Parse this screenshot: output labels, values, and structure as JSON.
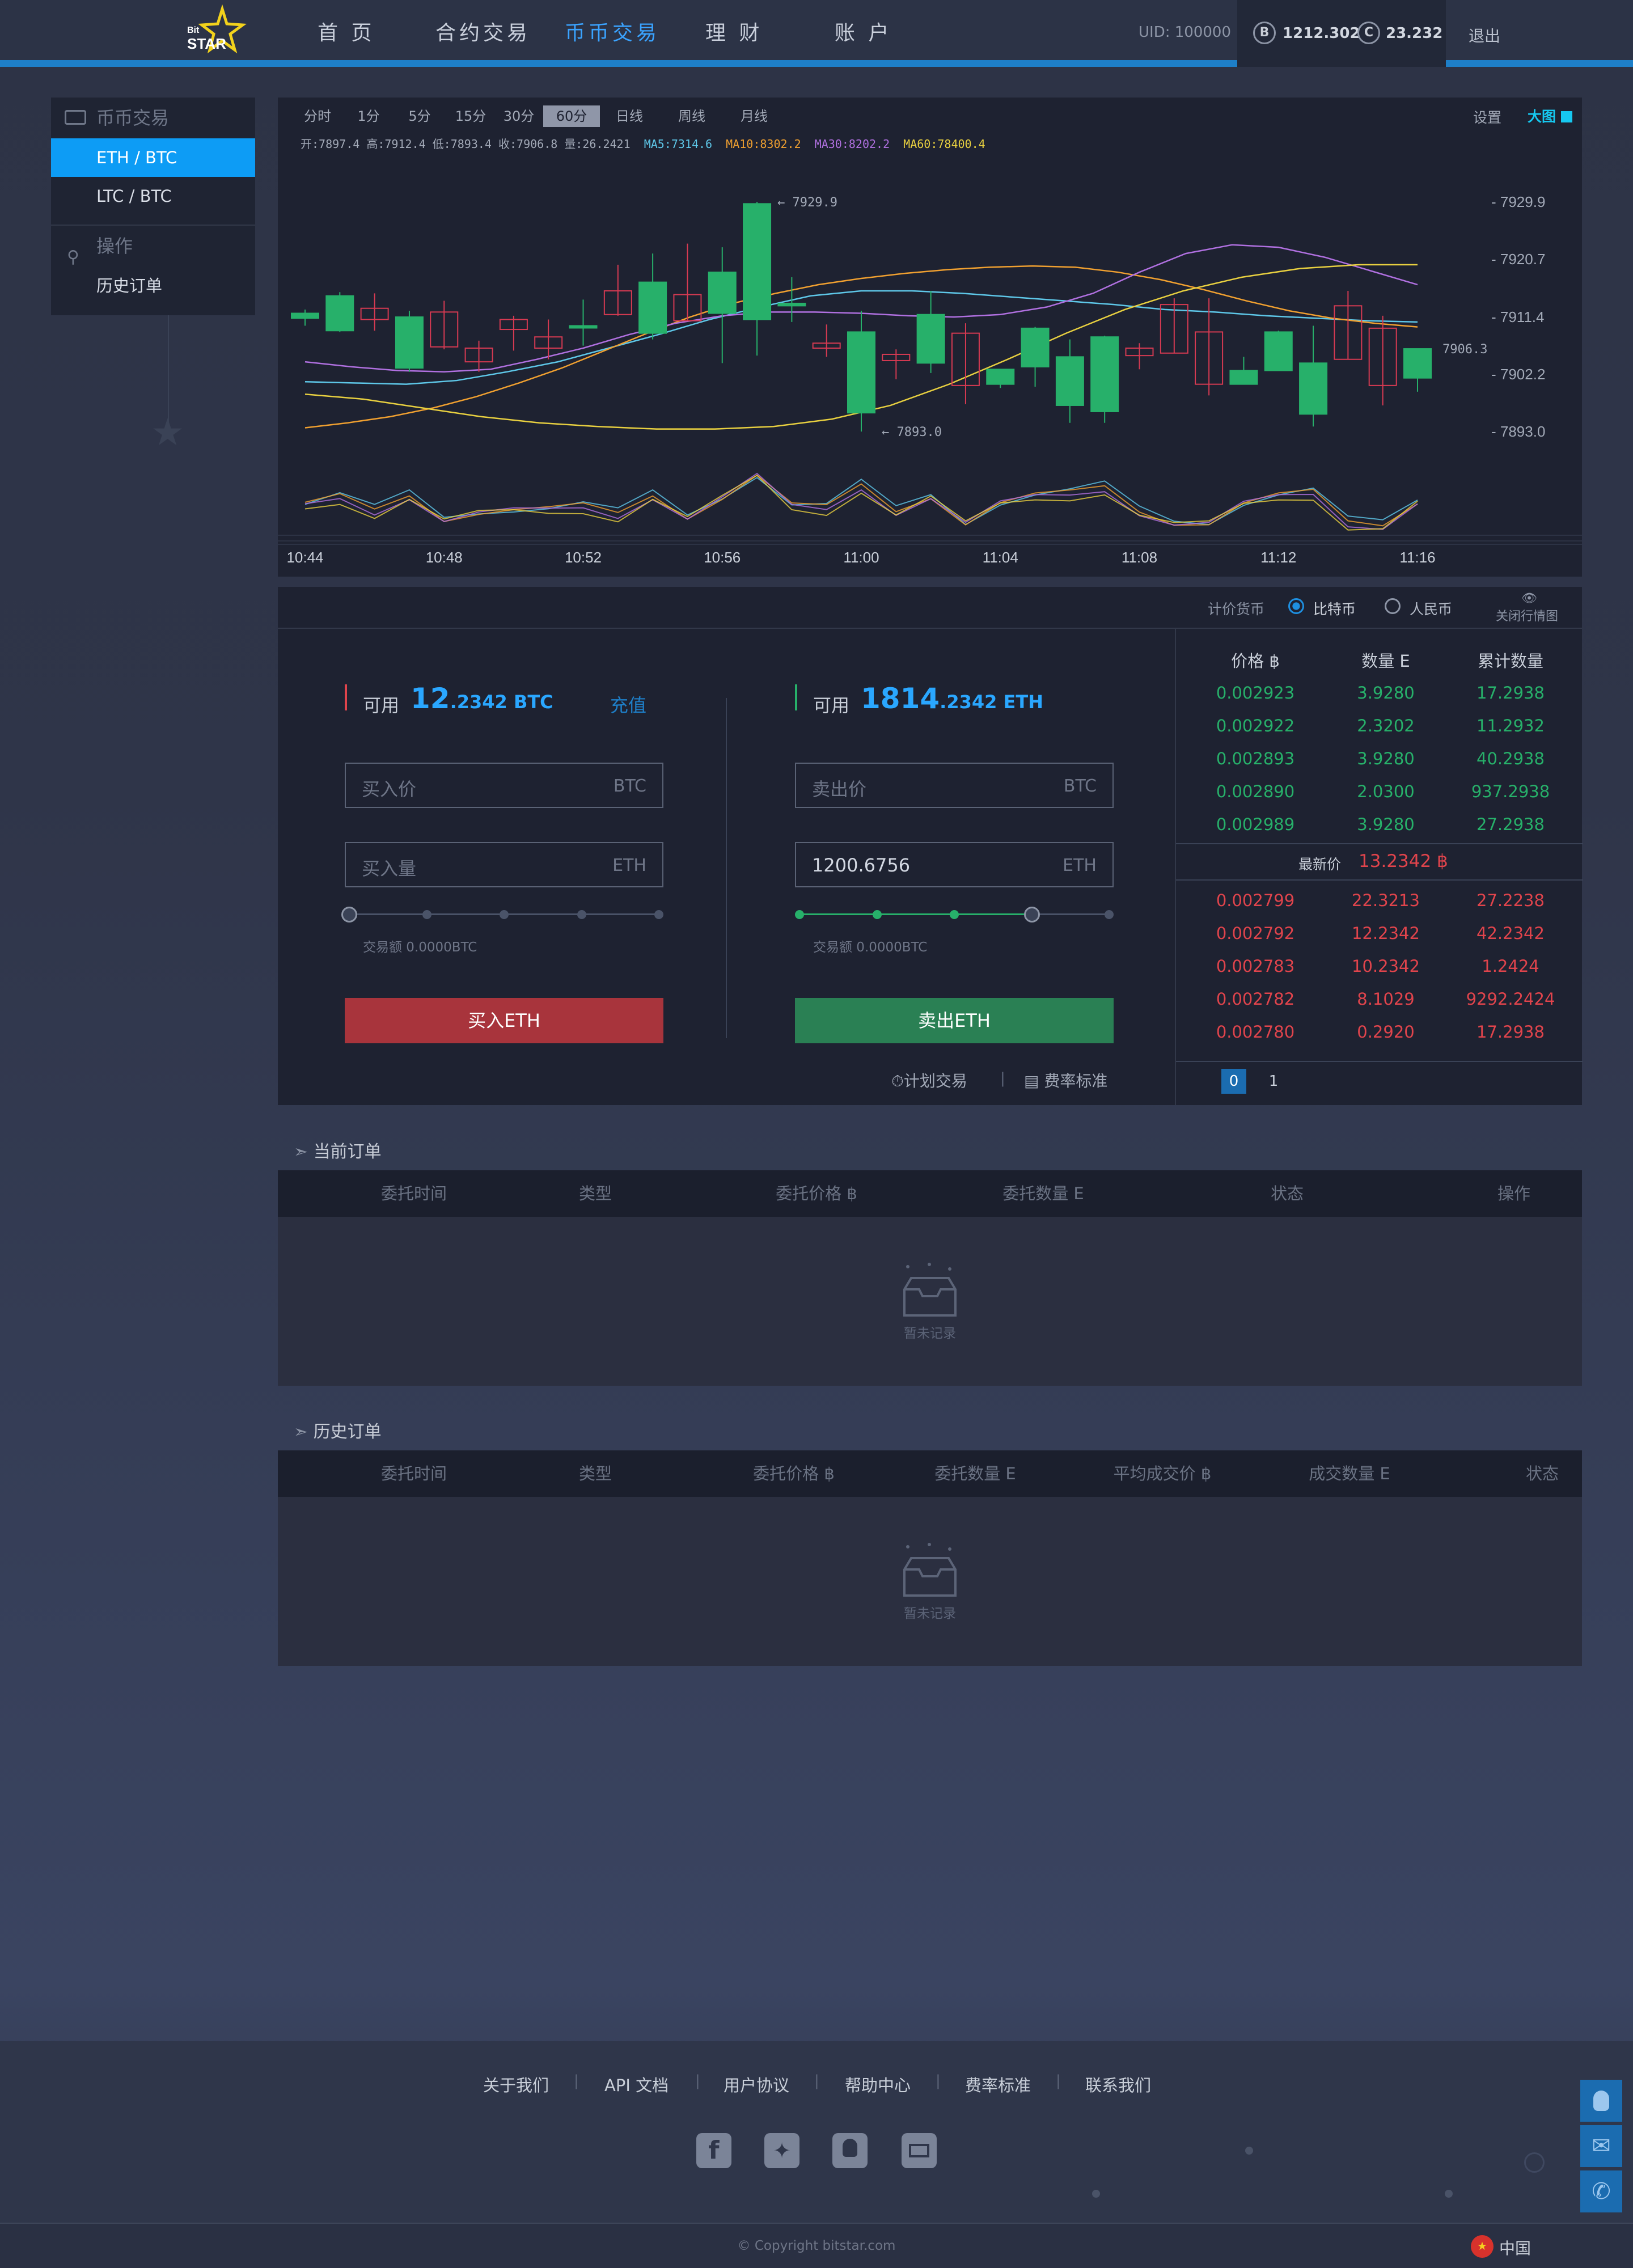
{
  "header": {
    "logo": {
      "small": "Bit",
      "big": "STAR"
    },
    "nav": [
      "首 页",
      "合约交易",
      "币币交易",
      "理 财",
      "账 户"
    ],
    "active_nav": 2,
    "uid_label": "UID: 100000",
    "balances": [
      {
        "icon": "bitcoin-icon",
        "value": "1212.302"
      },
      {
        "icon": "coin-c-icon",
        "value": "23.232"
      }
    ],
    "logout": "退出"
  },
  "sidebar": {
    "section1": "币币交易",
    "items": [
      "ETH / BTC",
      "LTC / BTC"
    ],
    "section2": "操作",
    "history": "历史订单"
  },
  "chart_toolbar": {
    "periods": [
      "分时",
      "1分",
      "5分",
      "15分",
      "30分",
      "60分",
      "日线",
      "周线",
      "月线"
    ],
    "active_period": "60分",
    "settings": "设置",
    "fullscreen": "大图"
  },
  "chart_info": {
    "ohlc": "开:7897.4  高:7912.4  低:7893.4  收:7906.8  量:26.2421",
    "ma5": "MA5:7314.6",
    "ma10": "MA10:8302.2",
    "ma30": "MA30:8202.2",
    "ma60": "MA60:78400.4"
  },
  "chart_data": {
    "type": "candlestick",
    "x": [
      "10:44",
      "10:45",
      "10:46",
      "10:47",
      "10:48",
      "10:49",
      "10:50",
      "10:51",
      "10:52",
      "10:53",
      "10:54",
      "10:55",
      "10:56",
      "10:57",
      "10:58",
      "10:59",
      "11:00",
      "11:01",
      "11:02",
      "11:03",
      "11:04",
      "11:05",
      "11:06",
      "11:07",
      "11:08",
      "11:09",
      "11:10",
      "11:11",
      "11:12",
      "11:13",
      "11:14",
      "11:15",
      "11:16"
    ],
    "candles": [
      {
        "o": 7911.2,
        "h": 7912.6,
        "l": 7910.0,
        "c": 7912.0
      },
      {
        "o": 7909.2,
        "h": 7915.4,
        "l": 7909.0,
        "c": 7914.8
      },
      {
        "o": 7912.8,
        "h": 7915.2,
        "l": 7909.2,
        "c": 7911.0
      },
      {
        "o": 7903.2,
        "h": 7912.4,
        "l": 7902.6,
        "c": 7911.4
      },
      {
        "o": 7912.2,
        "h": 7914.0,
        "l": 7906.2,
        "c": 7906.6
      },
      {
        "o": 7906.4,
        "h": 7907.6,
        "l": 7902.6,
        "c": 7904.2
      },
      {
        "o": 7911.0,
        "h": 7911.6,
        "l": 7906.0,
        "c": 7909.4
      },
      {
        "o": 7908.2,
        "h": 7911.0,
        "l": 7904.6,
        "c": 7906.4
      },
      {
        "o": 7909.8,
        "h": 7914.2,
        "l": 7906.8,
        "c": 7910.0
      },
      {
        "o": 7915.6,
        "h": 7919.8,
        "l": 7911.6,
        "c": 7911.8
      },
      {
        "o": 7908.8,
        "h": 7921.6,
        "l": 7907.8,
        "c": 7917.0
      },
      {
        "o": 7915.0,
        "h": 7923.2,
        "l": 7910.8,
        "c": 7910.8
      },
      {
        "o": 7912.0,
        "h": 7922.6,
        "l": 7904.0,
        "c": 7918.6
      },
      {
        "o": 7911.0,
        "h": 7929.9,
        "l": 7905.2,
        "c": 7929.6
      },
      {
        "o": 7913.2,
        "h": 7917.8,
        "l": 7910.6,
        "c": 7913.6
      },
      {
        "o": 7907.2,
        "h": 7910.2,
        "l": 7905.0,
        "c": 7906.4
      },
      {
        "o": 7896.0,
        "h": 7912.4,
        "l": 7893.0,
        "c": 7909.0
      },
      {
        "o": 7905.4,
        "h": 7906.2,
        "l": 7901.4,
        "c": 7904.4
      },
      {
        "o": 7904.0,
        "h": 7915.6,
        "l": 7902.4,
        "c": 7911.8
      },
      {
        "o": 7908.8,
        "h": 7910.4,
        "l": 7897.4,
        "c": 7900.4
      },
      {
        "o": 7900.6,
        "h": 7903.0,
        "l": 7900.0,
        "c": 7903.0
      },
      {
        "o": 7903.4,
        "h": 7909.8,
        "l": 7900.2,
        "c": 7909.6
      },
      {
        "o": 7897.2,
        "h": 7907.8,
        "l": 7894.4,
        "c": 7905.0
      },
      {
        "o": 7896.2,
        "h": 7908.4,
        "l": 7894.4,
        "c": 7908.2
      },
      {
        "o": 7906.4,
        "h": 7907.2,
        "l": 7903.0,
        "c": 7905.2
      },
      {
        "o": 7913.4,
        "h": 7914.4,
        "l": 7905.6,
        "c": 7905.6
      },
      {
        "o": 7909.0,
        "h": 7914.4,
        "l": 7898.8,
        "c": 7900.6
      },
      {
        "o": 7900.6,
        "h": 7905.0,
        "l": 7900.6,
        "c": 7902.8
      },
      {
        "o": 7902.8,
        "h": 7909.2,
        "l": 7902.8,
        "c": 7909.0
      },
      {
        "o": 7895.8,
        "h": 7910.0,
        "l": 7893.8,
        "c": 7904.0
      },
      {
        "o": 7913.2,
        "h": 7915.6,
        "l": 7904.6,
        "c": 7904.6
      },
      {
        "o": 7909.6,
        "h": 7911.6,
        "l": 7897.2,
        "c": 7900.4
      },
      {
        "o": 7901.6,
        "h": 7905.2,
        "l": 7899.4,
        "c": 7906.3
      }
    ],
    "ylim": [
      7890,
      7933
    ],
    "y_ticks": [
      "7929.9",
      "7920.7",
      "7911.4",
      "7902.2",
      "7893.0"
    ],
    "x_ticks": [
      "10:44",
      "10:48",
      "10:52",
      "10:56",
      "11:00",
      "11:04",
      "11:08",
      "11:12",
      "11:16"
    ],
    "annotations": {
      "max": "← 7929.9",
      "min": "← 7893.0",
      "last": "7906.3"
    },
    "ma_lines": [
      {
        "name": "MA5",
        "color": "#5ec7e8",
        "values": [
          7901,
          7900.8,
          7900.6,
          7901.2,
          7902.6,
          7904.2,
          7906.4,
          7908.6,
          7911.0,
          7913.0,
          7914.8,
          7915.6,
          7915.6,
          7915.2,
          7914.6,
          7914.0,
          7913.4,
          7912.6,
          7912.2,
          7911.6,
          7911.2,
          7910.8,
          7910.6
        ]
      },
      {
        "name": "MA10",
        "color": "#f0a030",
        "values": [
          7893.6,
          7894.4,
          7895.4,
          7896.8,
          7898.6,
          7900.8,
          7903.2,
          7906.0,
          7908.8,
          7911.4,
          7913.6,
          7915.2,
          7916.6,
          7917.6,
          7918.4,
          7919.0,
          7919.4,
          7919.6,
          7919.4,
          7918.6,
          7917.4,
          7915.8,
          7914.0,
          7912.4,
          7911.2,
          7910.4,
          7909.8
        ]
      },
      {
        "name": "MA30",
        "color": "#b070e0",
        "values": [
          7904.2,
          7903.4,
          7902.8,
          7902.6,
          7903.0,
          7904.6,
          7906.4,
          7908.6,
          7910.4,
          7911.6,
          7912.2,
          7912.2,
          7912.0,
          7911.6,
          7911.4,
          7911.8,
          7913.0,
          7915.2,
          7918.6,
          7921.6,
          7923.0,
          7922.6,
          7921.0,
          7918.8,
          7916.6
        ]
      },
      {
        "name": "MA60",
        "color": "#e8d040",
        "values": [
          7899.0,
          7898.2,
          7896.8,
          7895.4,
          7894.4,
          7893.8,
          7893.4,
          7893.4,
          7893.8,
          7895.0,
          7897.2,
          7900.6,
          7904.6,
          7908.8,
          7912.6,
          7915.6,
          7917.8,
          7919.2,
          7919.8,
          7919.8
        ]
      }
    ]
  },
  "market": {
    "pricing_label": "计价货币",
    "opt_btc": "比特币",
    "opt_cny": "人民币",
    "close_chart": "关闭行情图"
  },
  "buy": {
    "available": "可用",
    "int": "12",
    "dec": ".2342 BTC",
    "deposit": "充值",
    "price_ph": "买入价",
    "price_unit": "BTC",
    "qty_ph": "买入量",
    "qty_unit": "ETH",
    "amount": "交易额 0.0000BTC",
    "button": "买入ETH",
    "slider_level": 0
  },
  "sell": {
    "available": "可用",
    "int": "1814",
    "dec": ".2342 ETH",
    "price_ph": "卖出价",
    "price_unit": "BTC",
    "qty_value": "1200.6756",
    "qty_unit": "ETH",
    "amount": "交易额 0.0000BTC",
    "button": "卖出ETH",
    "slider_level": 0.75,
    "plan": "计划交易",
    "fee": "费率标准"
  },
  "orderbook": {
    "headers": [
      "价格 ฿",
      "数量 E",
      "累计数量"
    ],
    "asks": [
      [
        "0.002923",
        "3.9280",
        "17.2938"
      ],
      [
        "0.002922",
        "2.3202",
        "11.2932"
      ],
      [
        "0.002893",
        "3.9280",
        "40.2938"
      ],
      [
        "0.002890",
        "2.0300",
        "937.2938"
      ],
      [
        "0.002989",
        "3.9280",
        "27.2938"
      ]
    ],
    "latest_label": "最新价",
    "latest_value": "13.2342 ฿",
    "bids": [
      [
        "0.002799",
        "22.3213",
        "27.2238"
      ],
      [
        "0.002792",
        "12.2342",
        "42.2342"
      ],
      [
        "0.002783",
        "10.2342",
        "1.2424"
      ],
      [
        "0.002782",
        "8.1029",
        "9292.2424"
      ],
      [
        "0.002780",
        "0.2920",
        "17.2938"
      ]
    ],
    "pages": [
      "0",
      "1"
    ],
    "green": "#27b06a",
    "red": "#e0444c"
  },
  "current_orders": {
    "title": "当前订单",
    "headers": [
      "委托时间",
      "类型",
      "委托价格 ฿",
      "委托数量 E",
      "状态",
      "操作"
    ],
    "empty": "暂未记录"
  },
  "history_orders": {
    "title": "历史订单",
    "headers": [
      "委托时间",
      "类型",
      "委托价格 ฿",
      "委托数量 E",
      "平均成交价 ฿",
      "成交数量 E",
      "状态"
    ],
    "empty": "暂未记录"
  },
  "footer": {
    "links": [
      "关于我们",
      "API 文档",
      "用户协议",
      "帮助中心",
      "费率标准",
      "联系我们"
    ],
    "social": [
      "facebook-icon",
      "twitter-icon",
      "qq-group-icon",
      "mail-icon"
    ],
    "copyright": "© Copyright   bitstar.com",
    "region": "中国"
  }
}
